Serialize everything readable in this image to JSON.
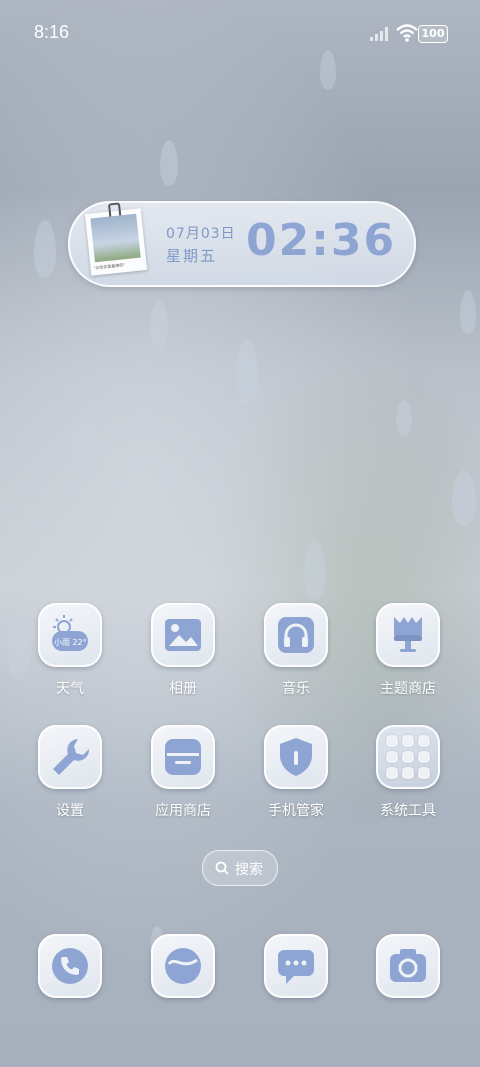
{
  "status_bar": {
    "time": "8:16",
    "battery": "100"
  },
  "widget": {
    "date": "07月03日",
    "weekday": "星期五",
    "time": "02:36",
    "photo_caption": "\"记住你是最棒的\""
  },
  "apps_row1": [
    {
      "label": "天气",
      "icon": "weather-icon",
      "weather_text": "小雨 22°"
    },
    {
      "label": "相册",
      "icon": "gallery-icon"
    },
    {
      "label": "音乐",
      "icon": "headphones-icon"
    },
    {
      "label": "主题商店",
      "icon": "brush-icon"
    }
  ],
  "apps_row2": [
    {
      "label": "设置",
      "icon": "wrench-icon"
    },
    {
      "label": "应用商店",
      "icon": "store-icon"
    },
    {
      "label": "手机管家",
      "icon": "shield-icon"
    },
    {
      "label": "系统工具",
      "icon": "folder-icon"
    }
  ],
  "search": {
    "label": "搜索"
  },
  "dock": [
    {
      "name": "phone",
      "icon": "phone-icon"
    },
    {
      "name": "browser",
      "icon": "globe-icon"
    },
    {
      "name": "messages",
      "icon": "message-icon"
    },
    {
      "name": "camera",
      "icon": "camera-icon"
    }
  ],
  "colors": {
    "icon_accent": "#8ea5d4",
    "icon_bg": "#eef1f6",
    "label": "#ffffff"
  }
}
